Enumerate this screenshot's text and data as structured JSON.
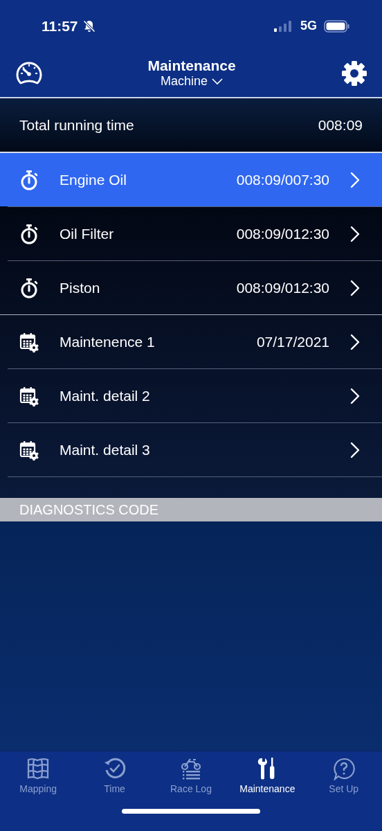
{
  "status_bar": {
    "time": "11:57",
    "network": "5G"
  },
  "header": {
    "title": "Maintenance",
    "subtitle": "Machine"
  },
  "total": {
    "label": "Total running time",
    "value": "008:09"
  },
  "items": [
    {
      "kind": "timer",
      "label": "Engine Oil",
      "value": "008:09/007:30",
      "selected": true
    },
    {
      "kind": "timer",
      "label": "Oil Filter",
      "value": "008:09/012:30",
      "selected": false
    },
    {
      "kind": "timer",
      "label": "Piston",
      "value": "008:09/012:30",
      "selected": false
    },
    {
      "kind": "schedule",
      "label": "Maintenence 1",
      "value": "07/17/2021",
      "selected": false
    },
    {
      "kind": "schedule",
      "label": "Maint. detail 2",
      "selected": false
    },
    {
      "kind": "schedule",
      "label": "Maint. detail 3",
      "selected": false
    }
  ],
  "diagnostics": {
    "title": "DIAGNOSTICS CODE"
  },
  "tabs": [
    {
      "kind": "map",
      "label": "Mapping",
      "selected": false
    },
    {
      "kind": "time",
      "label": "Time",
      "selected": false
    },
    {
      "kind": "racelog",
      "label": "Race Log",
      "selected": false
    },
    {
      "kind": "tools",
      "label": "Maintenance",
      "selected": true
    },
    {
      "kind": "help",
      "label": "Set Up",
      "selected": false
    }
  ]
}
